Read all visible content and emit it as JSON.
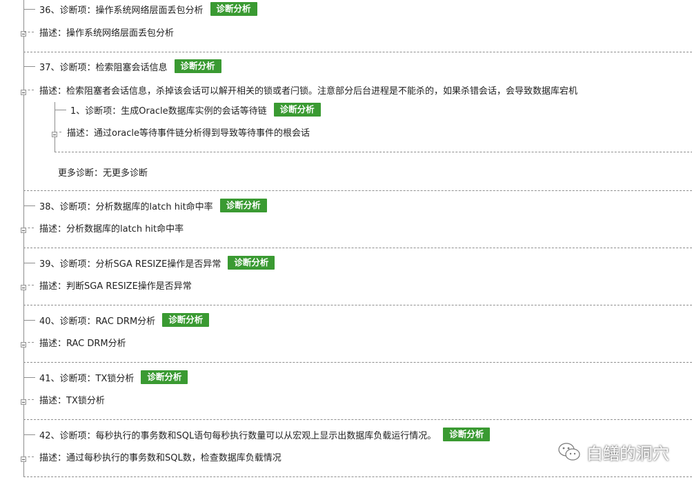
{
  "items": [
    {
      "title": "36、诊断项：操作系统网络层面丢包分析",
      "badge": "诊断分析",
      "desc": "描述：操作系统网络层面丢包分析"
    },
    {
      "title": "37、诊断项：检索阻塞会话信息",
      "badge": "诊断分析",
      "desc": "描述：检索阻塞者会话信息，杀掉该会话可以解开相关的锁或者闩锁。注意部分后台进程是不能杀的，如果杀错会话，会导致数据库宕机",
      "sub": {
        "title": "1、诊断项：生成Oracle数据库实例的会话等待链",
        "badge": "诊断分析",
        "desc": "描述：通过oracle等待事件链分析得到导致等待事件的根会话"
      },
      "more": "更多诊断：无更多诊断"
    },
    {
      "title": "38、诊断项：分析数据库的latch hit命中率",
      "badge": "诊断分析",
      "desc": "描述：分析数据库的latch hit命中率"
    },
    {
      "title": "39、诊断项：分析SGA RESIZE操作是否异常",
      "badge": "诊断分析",
      "desc": "描述：判断SGA RESIZE操作是否异常"
    },
    {
      "title": "40、诊断项：RAC DRM分析",
      "badge": "诊断分析",
      "desc": "描述：RAC DRM分析"
    },
    {
      "title": "41、诊断项：TX锁分析",
      "badge": "诊断分析",
      "desc": "描述：TX锁分析"
    },
    {
      "title": "42、诊断项：每秒执行的事务数和SQL语句每秒执行数量可以从宏观上显示出数据库负载运行情况。",
      "badge": "诊断分析",
      "desc": "描述：通过每秒执行的事务数和SQL数，检查数据库负载情况"
    }
  ],
  "watermark": {
    "text": "白鳝的洞穴",
    "icon": "wechat-icon"
  }
}
